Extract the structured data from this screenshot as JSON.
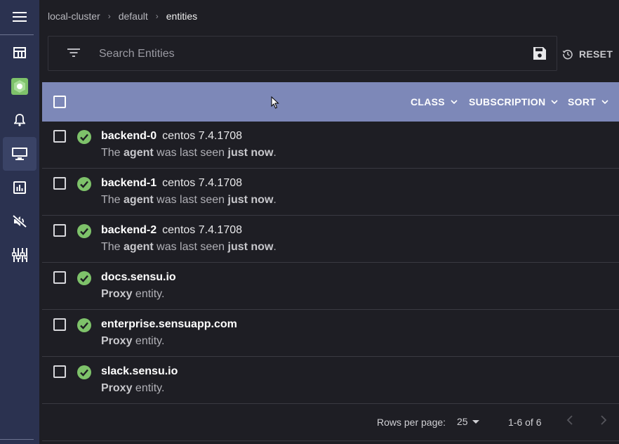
{
  "breadcrumb": {
    "cluster": "local-cluster",
    "namespace": "default",
    "page": "entities"
  },
  "search": {
    "placeholder": "Search Entities",
    "value": ""
  },
  "actions": {
    "reset_label": "RESET"
  },
  "toolbar": {
    "class_label": "CLASS",
    "subscription_label": "SUBSCRIPTION",
    "sort_label": "SORT"
  },
  "entities": [
    {
      "name": "backend-0",
      "os": "centos 7.4.1708",
      "desc_pre": "The ",
      "desc_b1": "agent",
      "desc_mid": " was last seen ",
      "desc_b2": "just now",
      "desc_post": ".",
      "status": "passing"
    },
    {
      "name": "backend-1",
      "os": "centos 7.4.1708",
      "desc_pre": "The ",
      "desc_b1": "agent",
      "desc_mid": " was last seen ",
      "desc_b2": "just now",
      "desc_post": ".",
      "status": "passing"
    },
    {
      "name": "backend-2",
      "os": "centos 7.4.1708",
      "desc_pre": "The ",
      "desc_b1": "agent",
      "desc_mid": " was last seen ",
      "desc_b2": "just now",
      "desc_post": ".",
      "status": "passing"
    },
    {
      "name": "docs.sensu.io",
      "os": "",
      "desc_pre": "",
      "desc_b1": "Proxy",
      "desc_mid": " entity.",
      "desc_b2": "",
      "desc_post": "",
      "status": "passing"
    },
    {
      "name": "enterprise.sensuapp.com",
      "os": "",
      "desc_pre": "",
      "desc_b1": "Proxy",
      "desc_mid": " entity.",
      "desc_b2": "",
      "desc_post": "",
      "status": "passing"
    },
    {
      "name": "slack.sensu.io",
      "os": "",
      "desc_pre": "",
      "desc_b1": "Proxy",
      "desc_mid": " entity.",
      "desc_b2": "",
      "desc_post": "",
      "status": "passing"
    }
  ],
  "pagination": {
    "rows_per_page_label": "Rows per page:",
    "rows_per_page": "25",
    "range": "1-6 of 6"
  },
  "colors": {
    "sidebar": "#2b3250",
    "toolbar": "#7d88b8",
    "status_ok": "#7ec26a",
    "background": "#1e1e24"
  },
  "icons": {
    "sidebar": [
      "menu-icon",
      "dashboard-icon",
      "sensu-logo-icon",
      "events-bell-icon",
      "entities-monitor-icon",
      "checks-chart-icon",
      "silences-mute-icon",
      "handlers-equalizer-icon"
    ]
  }
}
